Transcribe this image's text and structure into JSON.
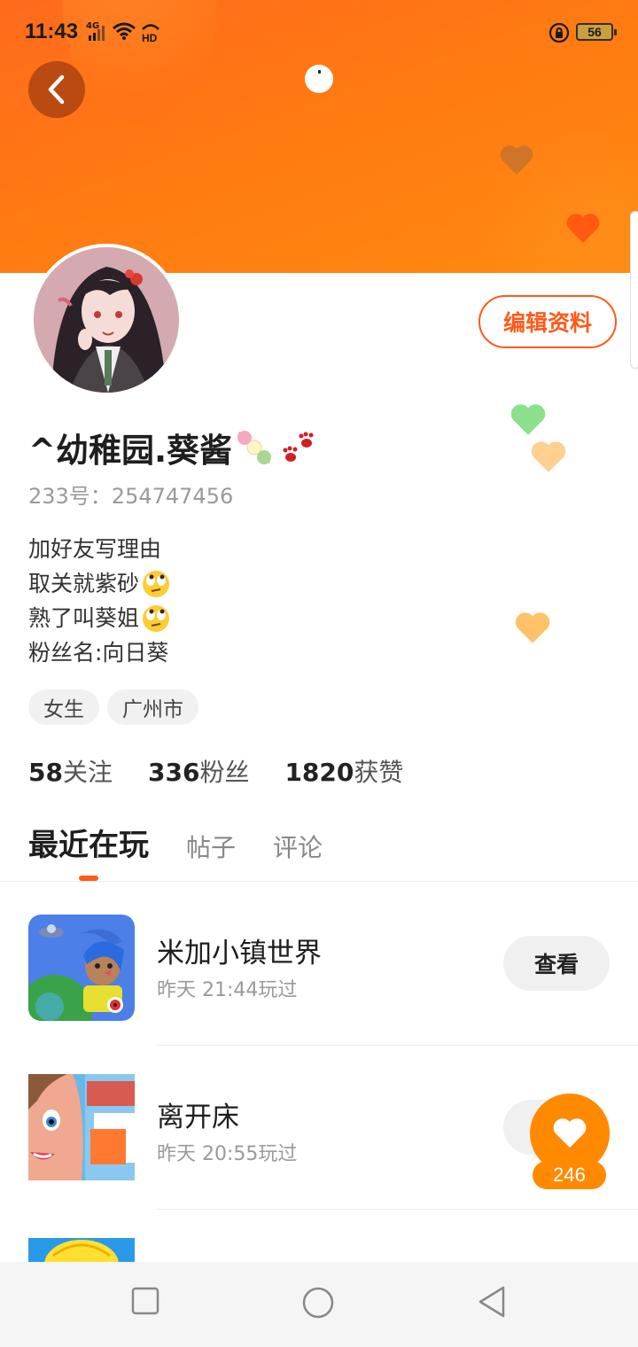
{
  "status_bar": {
    "time": "11:43",
    "network": "4G",
    "battery": "56"
  },
  "header": {
    "back_icon": "chevron-left-icon",
    "edit_profile_label": "编辑资料"
  },
  "profile": {
    "nickname": "^幼稚园.葵酱",
    "uid": "233号：254747456",
    "bio": [
      "加好友写理由",
      "取关就紫砂",
      "熟了叫葵姐",
      "粉丝名:向日葵"
    ],
    "tags": [
      "女生",
      "广州市"
    ],
    "stats": {
      "following_count": "58",
      "following_label": "关注",
      "fans_count": "336",
      "fans_label": "粉丝",
      "likes_count": "1820",
      "likes_label": "获赞"
    }
  },
  "tabs": [
    "最近在玩",
    "帖子",
    "评论"
  ],
  "recent_games": [
    {
      "name": "米加小镇世界",
      "time": "昨天 21:44玩过",
      "action": "查看"
    },
    {
      "name": "离开床",
      "time": "昨天 20:55玩过"
    }
  ],
  "like_badge": {
    "count": "246"
  },
  "colors": {
    "accent": "#ff5a1a",
    "banner": "#ff7a12",
    "fab": "#ff8a00"
  }
}
